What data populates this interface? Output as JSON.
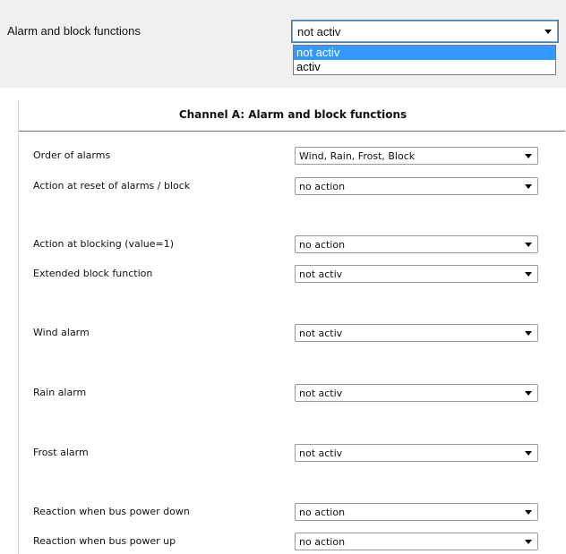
{
  "top_dropdown": {
    "label": "Alarm and block functions",
    "value": "not activ",
    "options": [
      "not activ",
      "activ"
    ]
  },
  "panel": {
    "title": "Channel A: Alarm and block functions",
    "rows": [
      {
        "label": "Order of alarms",
        "value": "Wind, Rain, Frost, Block"
      },
      {
        "label": "Action at reset of alarms / block",
        "value": "no action"
      },
      {
        "label": "Action at blocking (value=1)",
        "value": "no action"
      },
      {
        "label": "Extended block function",
        "value": "not activ"
      },
      {
        "label": "Wind alarm",
        "value": "not activ"
      },
      {
        "label": "Rain alarm",
        "value": "not activ"
      },
      {
        "label": "Frost alarm",
        "value": "not activ"
      },
      {
        "label": "Reaction when bus power down",
        "value": "no action"
      },
      {
        "label": "Reaction when bus power up",
        "value": "no action"
      }
    ]
  }
}
